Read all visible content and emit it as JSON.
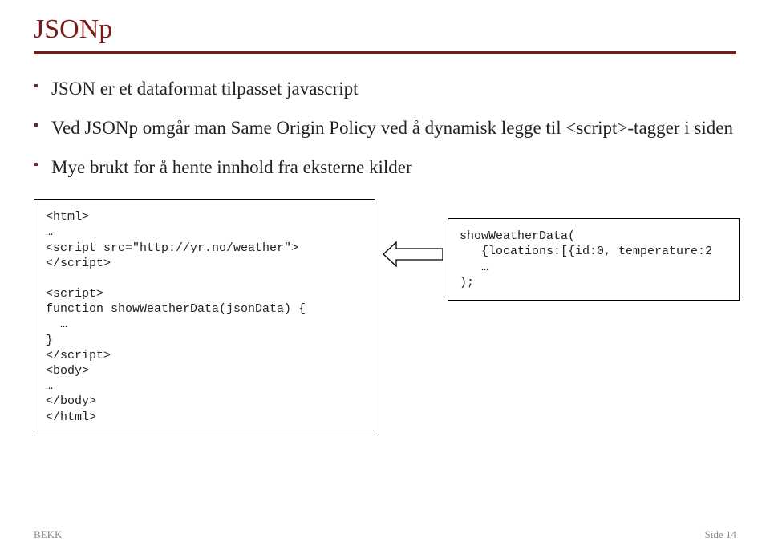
{
  "title": "JSONp",
  "bullets": [
    "JSON er et dataformat tilpasset javascript",
    "Ved JSONp omgår man Same Origin Policy ved å dynamisk legge til <script>-tagger i siden",
    "Mye brukt for å hente innhold fra eksterne kilder"
  ],
  "code_left": "<html>\n…\n<script src=\"http://yr.no/weather\">\n</script>\n\n<script>\nfunction showWeatherData(jsonData) {\n  …\n}\n</script>\n<body>\n…\n</body>\n</html>",
  "code_right": "showWeatherData(\n   {locations:[{id:0, temperature:2\n   …\n);",
  "footer": {
    "left": "BEKK",
    "right": "Side 14"
  }
}
